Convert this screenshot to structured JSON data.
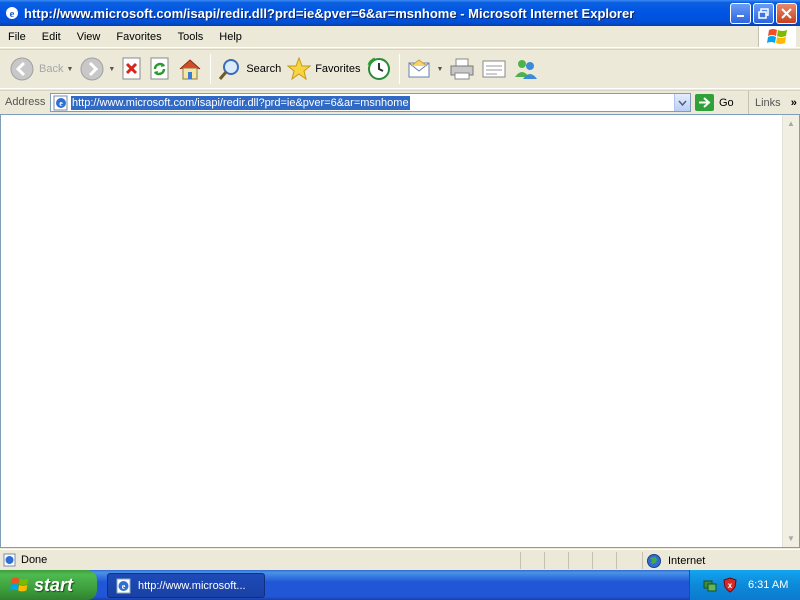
{
  "window": {
    "title": "http://www.microsoft.com/isapi/redir.dll?prd=ie&pver=6&ar=msnhome - Microsoft Internet Explorer"
  },
  "menu": {
    "items": [
      "File",
      "Edit",
      "View",
      "Favorites",
      "Tools",
      "Help"
    ]
  },
  "toolbar": {
    "back_label": "Back",
    "search_label": "Search",
    "favorites_label": "Favorites"
  },
  "address": {
    "label": "Address",
    "url": "http://www.microsoft.com/isapi/redir.dll?prd=ie&pver=6&ar=msnhome",
    "go_label": "Go",
    "links_label": "Links"
  },
  "status": {
    "text": "Done",
    "zone": "Internet"
  },
  "taskbar": {
    "start_label": "start",
    "task_label": "http://www.microsoft...",
    "clock": "6:31 AM"
  },
  "colors": {
    "titlebar": "#0054e3",
    "selection": "#316ac5",
    "start_green": "#3a9a3a",
    "taskbar_blue": "#2157d7"
  }
}
